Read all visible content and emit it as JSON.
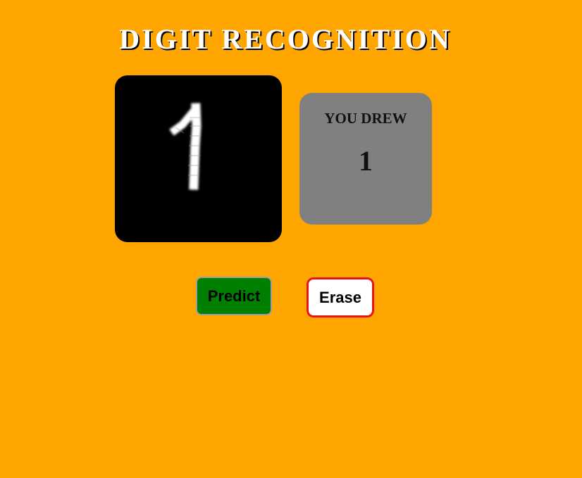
{
  "header": {
    "title": "DIGIT RECOGNITION"
  },
  "drawing_canvas": {
    "background": "#000000",
    "stroke_color": "#ffffff",
    "drawn_digit": "1"
  },
  "result": {
    "label": "YOU DREW",
    "value": "1"
  },
  "actions": {
    "predict_label": "Predict",
    "erase_label": "Erase"
  },
  "colors": {
    "page_background": "#FFA500",
    "predict_button": "#008000",
    "erase_border": "#e8141a",
    "result_panel": "#808080"
  }
}
